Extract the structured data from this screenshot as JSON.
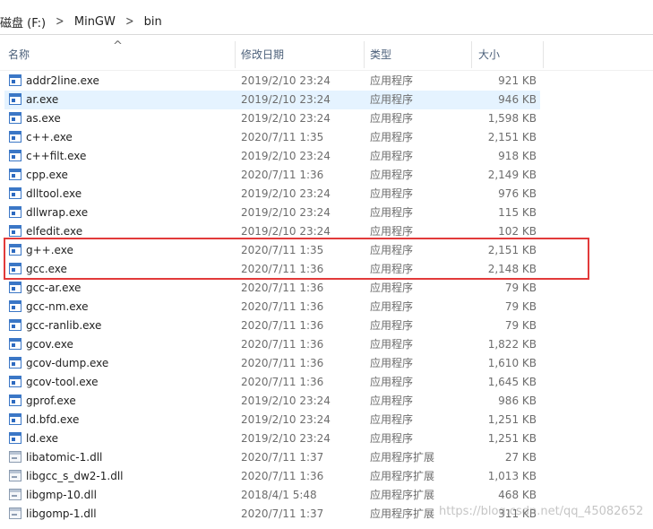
{
  "breadcrumb": {
    "drive": "磁盘 (F:)",
    "folder1": "MinGW",
    "folder2": "bin"
  },
  "columns": {
    "name": "名称",
    "date": "修改日期",
    "type": "类型",
    "size": "大小"
  },
  "files": [
    {
      "name": "addr2line.exe",
      "date": "2019/2/10 23:24",
      "type": "应用程序",
      "size": "921 KB",
      "icon": "exe-icon"
    },
    {
      "name": "ar.exe",
      "date": "2019/2/10 23:24",
      "type": "应用程序",
      "size": "946 KB",
      "icon": "exe-icon"
    },
    {
      "name": "as.exe",
      "date": "2019/2/10 23:24",
      "type": "应用程序",
      "size": "1,598 KB",
      "icon": "exe-icon"
    },
    {
      "name": "c++.exe",
      "date": "2020/7/11 1:35",
      "type": "应用程序",
      "size": "2,151 KB",
      "icon": "exe-icon"
    },
    {
      "name": "c++filt.exe",
      "date": "2019/2/10 23:24",
      "type": "应用程序",
      "size": "918 KB",
      "icon": "exe-icon"
    },
    {
      "name": "cpp.exe",
      "date": "2020/7/11 1:36",
      "type": "应用程序",
      "size": "2,149 KB",
      "icon": "exe-icon"
    },
    {
      "name": "dlltool.exe",
      "date": "2019/2/10 23:24",
      "type": "应用程序",
      "size": "976 KB",
      "icon": "exe-icon"
    },
    {
      "name": "dllwrap.exe",
      "date": "2019/2/10 23:24",
      "type": "应用程序",
      "size": "115 KB",
      "icon": "exe-icon"
    },
    {
      "name": "elfedit.exe",
      "date": "2019/2/10 23:24",
      "type": "应用程序",
      "size": "102 KB",
      "icon": "exe-icon"
    },
    {
      "name": "g++.exe",
      "date": "2020/7/11 1:35",
      "type": "应用程序",
      "size": "2,151 KB",
      "icon": "exe-icon"
    },
    {
      "name": "gcc.exe",
      "date": "2020/7/11 1:36",
      "type": "应用程序",
      "size": "2,148 KB",
      "icon": "exe-icon"
    },
    {
      "name": "gcc-ar.exe",
      "date": "2020/7/11 1:36",
      "type": "应用程序",
      "size": "79 KB",
      "icon": "exe-icon"
    },
    {
      "name": "gcc-nm.exe",
      "date": "2020/7/11 1:36",
      "type": "应用程序",
      "size": "79 KB",
      "icon": "exe-icon"
    },
    {
      "name": "gcc-ranlib.exe",
      "date": "2020/7/11 1:36",
      "type": "应用程序",
      "size": "79 KB",
      "icon": "exe-icon"
    },
    {
      "name": "gcov.exe",
      "date": "2020/7/11 1:36",
      "type": "应用程序",
      "size": "1,822 KB",
      "icon": "exe-icon"
    },
    {
      "name": "gcov-dump.exe",
      "date": "2020/7/11 1:36",
      "type": "应用程序",
      "size": "1,610 KB",
      "icon": "exe-icon"
    },
    {
      "name": "gcov-tool.exe",
      "date": "2020/7/11 1:36",
      "type": "应用程序",
      "size": "1,645 KB",
      "icon": "exe-icon"
    },
    {
      "name": "gprof.exe",
      "date": "2019/2/10 23:24",
      "type": "应用程序",
      "size": "986 KB",
      "icon": "exe-icon"
    },
    {
      "name": "ld.bfd.exe",
      "date": "2019/2/10 23:24",
      "type": "应用程序",
      "size": "1,251 KB",
      "icon": "exe-icon"
    },
    {
      "name": "ld.exe",
      "date": "2019/2/10 23:24",
      "type": "应用程序",
      "size": "1,251 KB",
      "icon": "exe-icon"
    },
    {
      "name": "libatomic-1.dll",
      "date": "2020/7/11 1:37",
      "type": "应用程序扩展",
      "size": "27 KB",
      "icon": "dll-icon"
    },
    {
      "name": "libgcc_s_dw2-1.dll",
      "date": "2020/7/11 1:36",
      "type": "应用程序扩展",
      "size": "1,013 KB",
      "icon": "dll-icon"
    },
    {
      "name": "libgmp-10.dll",
      "date": "2018/4/1 5:48",
      "type": "应用程序扩展",
      "size": "468 KB",
      "icon": "dll-icon"
    },
    {
      "name": "libgomp-1.dll",
      "date": "2020/7/11 1:37",
      "type": "应用程序扩展",
      "size": "311 KB",
      "icon": "dll-icon"
    }
  ],
  "hovered_row": 1,
  "highlight_color": "#e23a3a",
  "watermark": "https://blog.csdn.net/qq_45082652"
}
